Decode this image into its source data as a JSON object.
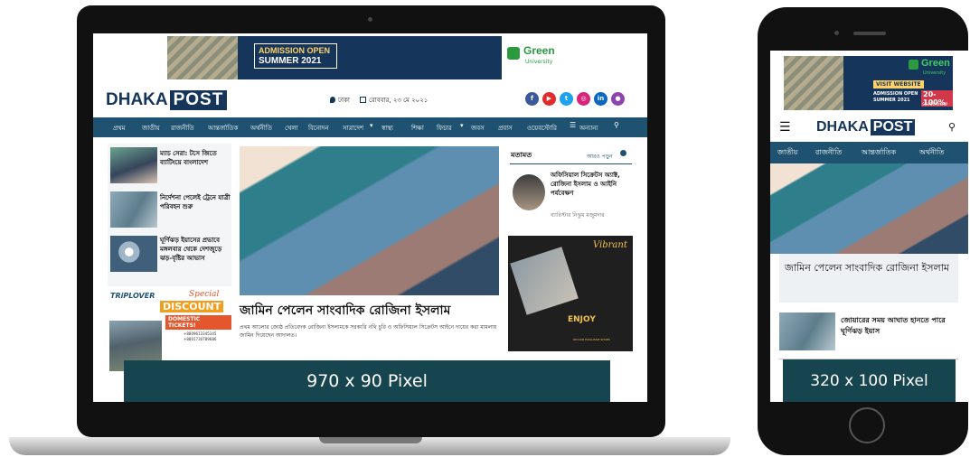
{
  "colors": {
    "nav_bg": "#1f5270",
    "brand_blue": "#16355a",
    "promo_box": "#17454f",
    "bezel": "#111111",
    "banner_green": "#2b9a3f"
  },
  "desktop": {
    "ad": {
      "line1": "ADMISSION OPEN",
      "line2": "SUMMER 2021",
      "brand_top": "Green",
      "brand_bottom": "University"
    },
    "header": {
      "logo_left": "DHAKA",
      "logo_right": "POST",
      "location": "ঢাকা",
      "date": "রোববার, ২৩ মে ২০২১",
      "location_icon": "location-icon",
      "calendar_icon": "calendar-icon"
    },
    "social_icons": [
      {
        "name": "facebook-icon",
        "glyph": "f",
        "color": "#3b5998"
      },
      {
        "name": "youtube-icon",
        "glyph": "▶",
        "color": "#e12b2b"
      },
      {
        "name": "twitter-icon",
        "glyph": "t",
        "color": "#1da1f2"
      },
      {
        "name": "instagram-icon",
        "glyph": "◎",
        "color": "#d6247a"
      },
      {
        "name": "linkedin-icon",
        "glyph": "in",
        "color": "#0a66c2"
      },
      {
        "name": "podcast-icon",
        "glyph": "●",
        "color": "#8e44ad"
      }
    ],
    "nav": [
      "প্রথম",
      "জাতীয়",
      "রাজনীতি",
      "আন্তর্জাতিক",
      "অর্থনীতি",
      "খেলা",
      "বিনোদন",
      "সারাদেশ",
      "স্বাস্থ্য",
      "শিক্ষা",
      "ফিচার",
      "জবস",
      "প্রবাস",
      "ওয়েবস্টোরি",
      "অন্যান্য"
    ],
    "left_news": [
      "ম্যাচ সেরা: টসে জিতে ব্যাটিংয়ে বাংলাদেশ",
      "নির্দেশনা পেলেই ট্রেনে যাত্রী পরিবহন শুরু",
      "ঘূর্ণিঝড় ইয়াসের প্রভাবে মঙ্গলবার থেকে দেশজুড়ে ঝড়-বৃষ্টির আভাস"
    ],
    "left_ad": {
      "brand": "TRiPLOVER",
      "special": "Special",
      "discount": "DISCOUNT",
      "tickets": "DOMESTIC TICKETS!",
      "phone1": "+8809613345345",
      "phone2": "+8801730789686"
    },
    "headline": "জামিন পেলেন সাংবাদিক রোজিনা ইসলাম",
    "summary": "প্রথম আলোর জ্যেষ্ঠ প্রতিবেদক রোজিনা ইসলামকে সরকারি নথি চুরি ও অফিসিয়াল সিক্রেটস আইনে দায়ের করা মামলায় জামিন দিয়েছেন আদালত।",
    "opinion": {
      "title": "মতামত",
      "more": "আরও পড়ুন",
      "item_title": "অফিসিয়াল সিক্রেটস অ্যাক্ট, রোজিনা ইসলাম ও আইনি পর্যবেক্ষণ",
      "author": "ব্যারিস্টার নিঝুম মজুমদার"
    },
    "right_ad": {
      "brand": "Vibrant",
      "enjoy": "ENJOY",
      "tagline": "ON OUR EXCLUSIVE SHOES"
    }
  },
  "mobile": {
    "ad": {
      "brand_top": "Green",
      "brand_bottom": "University",
      "visit": "VISIT WEBSITE",
      "admission": "ADMISSION OPEN",
      "summer": "SUMMER 2021",
      "percent": "20-100%",
      "scholarship": "SCHOLARSHIP"
    },
    "nav": [
      "জাতীয়",
      "রাজনীতি",
      "আন্তর্জাতিক",
      "অর্থনীতি"
    ],
    "headline": "জামিন পেলেন সাংবাদিক রোজিনা ইসলাম",
    "news": "জোয়ারের সময় আঘাত হানতে পারে ঘূর্ণিঝড় ইয়াস"
  },
  "labels": {
    "desktop_size": "970 x 90 Pixel",
    "mobile_size": "320 x 100 Pixel"
  }
}
